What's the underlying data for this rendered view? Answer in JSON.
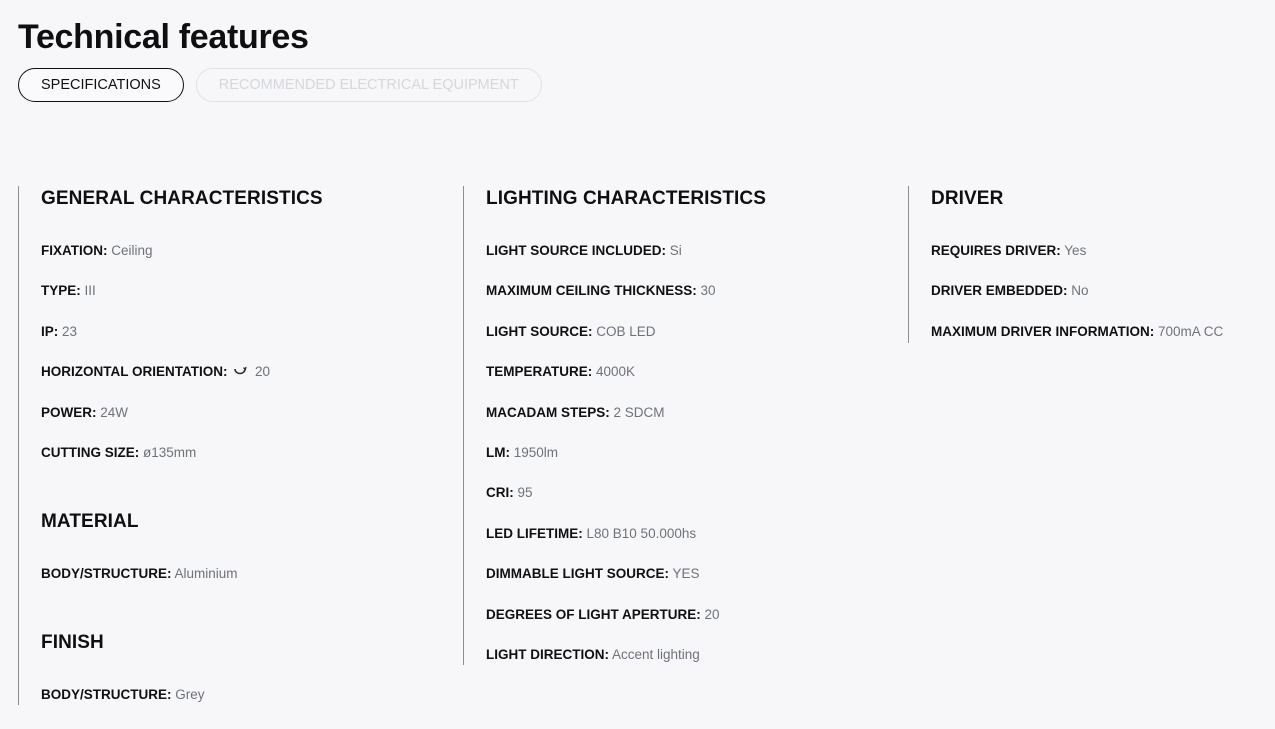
{
  "page": {
    "title": "Technical features"
  },
  "tabs": [
    {
      "label": "SPECIFICATIONS",
      "active": true
    },
    {
      "label": "RECOMMENDED ELECTRICAL EQUIPMENT",
      "active": false
    }
  ],
  "general": {
    "title": "GENERAL CHARACTERISTICS",
    "specs": [
      {
        "label": "FIXATION:",
        "value": "Ceiling"
      },
      {
        "label": "TYPE:",
        "value": "III"
      },
      {
        "label": "IP:",
        "value": "23"
      },
      {
        "label": "HORIZONTAL ORIENTATION:",
        "value": "20",
        "icon": "rotate-arc-icon"
      },
      {
        "label": "POWER:",
        "value": "24W"
      },
      {
        "label": "CUTTING SIZE:",
        "value": "ø135mm"
      }
    ]
  },
  "material": {
    "title": "MATERIAL",
    "specs": [
      {
        "label": "BODY/STRUCTURE:",
        "value": "Aluminium"
      }
    ]
  },
  "finish": {
    "title": "FINISH",
    "specs": [
      {
        "label": "BODY/STRUCTURE:",
        "value": "Grey"
      }
    ]
  },
  "lighting": {
    "title": "LIGHTING CHARACTERISTICS",
    "specs": [
      {
        "label": "LIGHT SOURCE INCLUDED:",
        "value": "Si"
      },
      {
        "label": "MAXIMUM CEILING THICKNESS:",
        "value": "30"
      },
      {
        "label": "LIGHT SOURCE:",
        "value": "COB LED"
      },
      {
        "label": "TEMPERATURE:",
        "value": "4000K"
      },
      {
        "label": "MACADAM STEPS:",
        "value": "2 SDCM"
      },
      {
        "label": "LM:",
        "value": "1950lm"
      },
      {
        "label": "CRI:",
        "value": "95"
      },
      {
        "label": "LED LIFETIME:",
        "value": "L80 B10 50.000hs"
      },
      {
        "label": "DIMMABLE LIGHT SOURCE:",
        "value": "YES"
      },
      {
        "label": "DEGREES OF LIGHT APERTURE:",
        "value": "20"
      },
      {
        "label": "LIGHT DIRECTION:",
        "value": "Accent lighting"
      }
    ]
  },
  "driver": {
    "title": "DRIVER",
    "specs": [
      {
        "label": "REQUIRES DRIVER:",
        "value": "Yes"
      },
      {
        "label": "DRIVER EMBEDDED:",
        "value": "No"
      },
      {
        "label": "MAXIMUM DRIVER INFORMATION:",
        "value": "700mA CC"
      }
    ]
  }
}
